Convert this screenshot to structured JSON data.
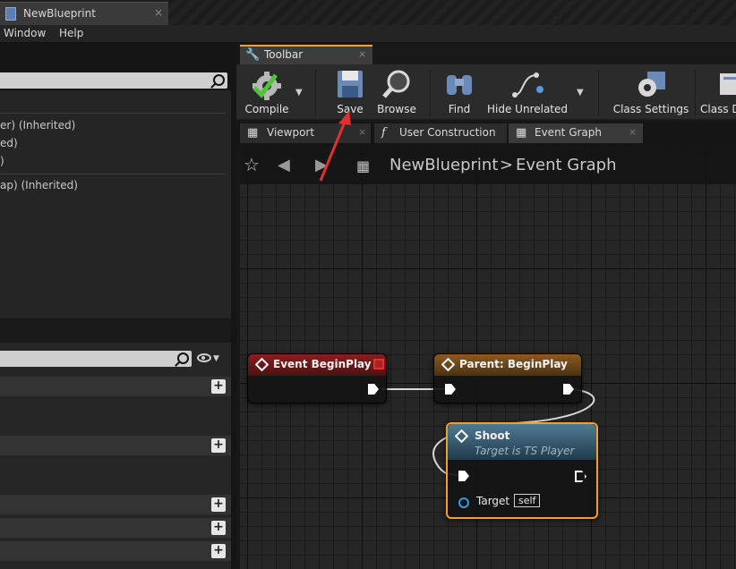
{
  "window": {
    "tab_title": "NewBlueprint",
    "tab_close": "×"
  },
  "menu": [
    "Window",
    "Help"
  ],
  "left_panel": {
    "rows": [
      "er) (Inherited)",
      "ed)",
      ")",
      "ap) (Inherited)"
    ]
  },
  "toolbar": {
    "tab_label": "Toolbar",
    "tab_close": "×",
    "buttons": {
      "compile": "Compile",
      "save": "Save",
      "browse": "Browse",
      "find": "Find",
      "hide_unrelated": "Hide Unrelated",
      "class_settings": "Class Settings",
      "class_defaults": "Class D"
    }
  },
  "editor_tabs": {
    "viewport": "Viewport",
    "user_construction": "User Construction",
    "event_graph": "Event Graph",
    "close": "×"
  },
  "breadcrumb": {
    "blueprint": "NewBlueprint",
    "separator": ">",
    "graph": "Event Graph"
  },
  "nodes": {
    "begin_play": {
      "title": "Event BeginPlay",
      "color": "#7a1c1c"
    },
    "parent_begin_play": {
      "title": "Parent: BeginPlay",
      "color": "#7a4a1a"
    },
    "shoot": {
      "title": "Shoot",
      "subtitle": "Target is TS Player",
      "pin_label": "Target",
      "pin_value": "self",
      "color": "#3a5a70",
      "highlight": "#f0a030"
    }
  },
  "annotation": {
    "arrow_color": "#e03030"
  }
}
